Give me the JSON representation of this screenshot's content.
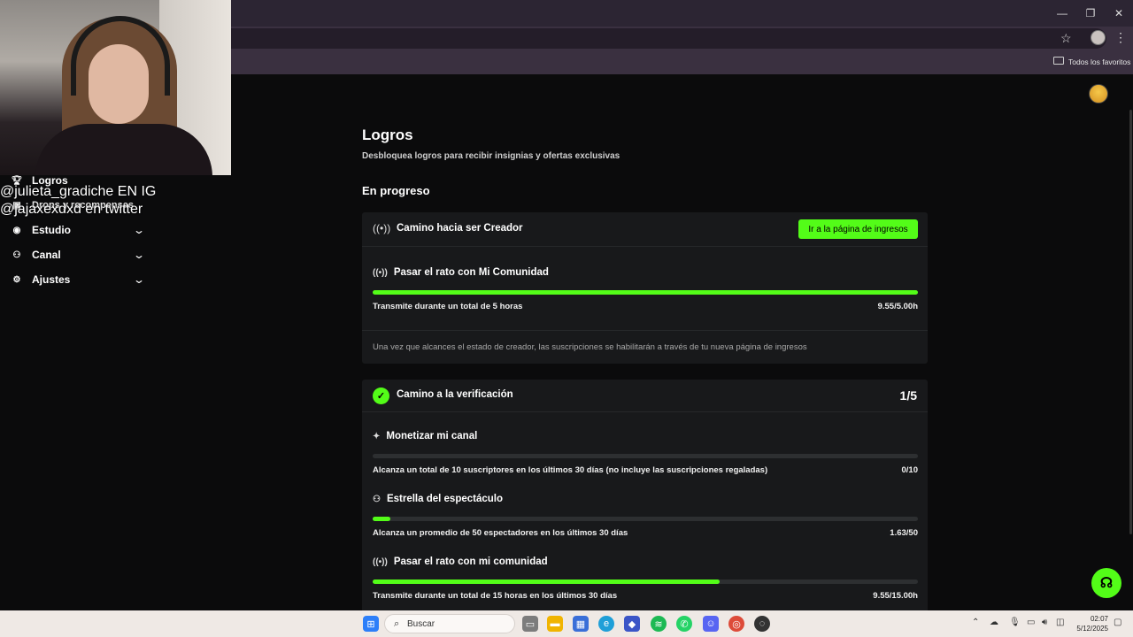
{
  "browser": {
    "bookmarks_folder": "Todos los favoritos",
    "window_controls": {
      "minimize": "—",
      "restore": "❐",
      "close": "✕"
    }
  },
  "stream_overlay": {
    "line1": "@julieta_gradiche EN IG",
    "line2": "@jajaxexdxd en twitter"
  },
  "sidebar": {
    "items": [
      {
        "label": "Logros",
        "icon": "trophy-icon"
      },
      {
        "label": "Drops y recompensas",
        "icon": "gift-icon"
      },
      {
        "label": "Estudio",
        "icon": "camera-icon"
      },
      {
        "label": "Canal",
        "icon": "users-icon"
      },
      {
        "label": "Ajustes",
        "icon": "gear-icon"
      }
    ]
  },
  "main": {
    "title": "Logros",
    "subtitle": "Desbloquea logros para recibir insignias y ofertas exclusivas",
    "section": "En progreso",
    "creator_card": {
      "title": "Camino hacia ser Creador",
      "button": "Ir a la página de ingresos",
      "task": {
        "title": "Pasar el rato con Mi Comunidad",
        "desc": "Transmite durante un total de 5 horas",
        "value": "9.55/5.00h",
        "progress": 1.0
      },
      "note": "Una vez que alcances el estado de creador, las suscripciones se habilitarán a través de tu nueva página de ingresos"
    },
    "verification_card": {
      "title": "Camino a la verificación",
      "count": "1/5",
      "tasks": [
        {
          "title": "Monetizar mi canal",
          "icon": "sparkle-icon",
          "desc": "Alcanza un total de 10 suscriptores en los últimos 30 días (no incluye las suscripciones regaladas)",
          "value": "0/10",
          "progress": 0.0
        },
        {
          "title": "Estrella del espectáculo",
          "icon": "users-icon",
          "desc": "Alcanza un promedio de 50 espectadores en los últimos 30 días",
          "value": "1.63/50",
          "progress": 0.0326
        },
        {
          "title": "Pasar el rato con mi comunidad",
          "icon": "broadcast-icon",
          "desc": "Transmite durante un total de 15 horas en los últimos 30 días",
          "value": "9.55/15.00h",
          "progress": 0.6367
        }
      ]
    }
  },
  "taskbar": {
    "search": "Buscar",
    "time": "02:07",
    "date": "5/12/2025"
  },
  "colors": {
    "accent": "#53fc18",
    "card_bg": "#18191b",
    "page_bg": "#0b0b0c",
    "chrome_frame": "#2c2533"
  }
}
